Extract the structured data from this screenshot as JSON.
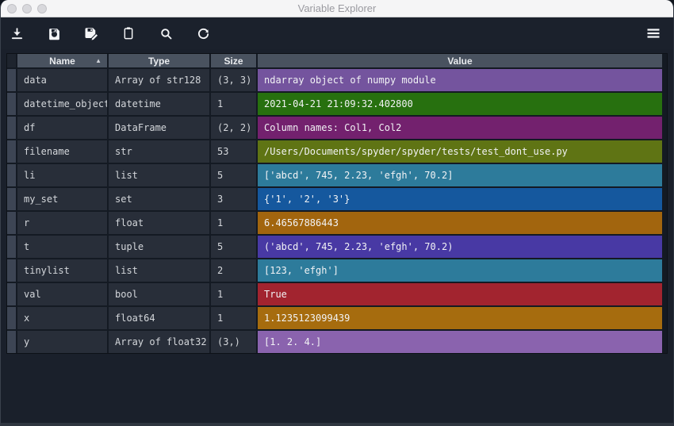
{
  "window": {
    "title": "Variable Explorer"
  },
  "titlebar": {
    "traffic_lights": [
      "close",
      "minimize",
      "zoom"
    ],
    "state": "inactive"
  },
  "toolbar": {
    "buttons": [
      {
        "id": "import-data",
        "icon": "import-icon"
      },
      {
        "id": "save-data",
        "icon": "save-icon"
      },
      {
        "id": "save-data-as",
        "icon": "save-as-icon"
      },
      {
        "id": "paste-data",
        "icon": "paste-icon"
      },
      {
        "id": "search",
        "icon": "search-icon"
      },
      {
        "id": "refresh",
        "icon": "refresh-icon"
      }
    ],
    "menu_button": {
      "id": "options-menu",
      "icon": "hamburger-icon"
    }
  },
  "table": {
    "columns": [
      {
        "label": "Name"
      },
      {
        "label": "Type"
      },
      {
        "label": "Size"
      },
      {
        "label": "Value"
      }
    ],
    "sort": {
      "column": "Name",
      "direction": "asc",
      "indicator": "▲"
    },
    "rows": [
      {
        "name": "data",
        "type": "Array of str128",
        "size": "(3, 3)",
        "value": "ndarray object of numpy module",
        "color": "#74549e"
      },
      {
        "name": "datetime_object",
        "type": "datetime",
        "size": "1",
        "value": "2021-04-21 21:09:32.402800",
        "color": "#27700f"
      },
      {
        "name": "df",
        "type": "DataFrame",
        "size": "(2, 2)",
        "value": "Column names: Col1, Col2",
        "color": "#73216e"
      },
      {
        "name": "filename",
        "type": "str",
        "size": "53",
        "value": "/Users/Documents/spyder/spyder/tests/test_dont_use.py",
        "color": "#5f7414"
      },
      {
        "name": "li",
        "type": "list",
        "size": "5",
        "value": "['abcd', 745, 2.23, 'efgh', 70.2]",
        "color": "#2d7b9b"
      },
      {
        "name": "my_set",
        "type": "set",
        "size": "3",
        "value": "{'1', '2', '3'}",
        "color": "#15589e"
      },
      {
        "name": "r",
        "type": "float",
        "size": "1",
        "value": "6.46567886443",
        "color": "#a2650e"
      },
      {
        "name": "t",
        "type": "tuple",
        "size": "5",
        "value": "('abcd', 745, 2.23, 'efgh', 70.2)",
        "color": "#4839a4"
      },
      {
        "name": "tinylist",
        "type": "list",
        "size": "2",
        "value": "[123, 'efgh']",
        "color": "#2d7b9b"
      },
      {
        "name": "val",
        "type": "bool",
        "size": "1",
        "value": "True",
        "color": "#a2242f"
      },
      {
        "name": "x",
        "type": "float64",
        "size": "1",
        "value": "1.1235123099439",
        "color": "#a66c0e"
      },
      {
        "name": "y",
        "type": "Array of float32",
        "size": "(3,)",
        "value": "[1. 2. 4.]",
        "color": "#8a63ae"
      }
    ]
  },
  "colors": {
    "titlebar_bg": "#f5f5f6",
    "toolbar_bg": "#1b212c",
    "panel_bg": "#1a202b",
    "header_bg": "#49525f",
    "cell_bg": "#282e39",
    "gutter_bg": "#3d4554",
    "separator": "#141a23",
    "icon": "#f4f5f7"
  }
}
